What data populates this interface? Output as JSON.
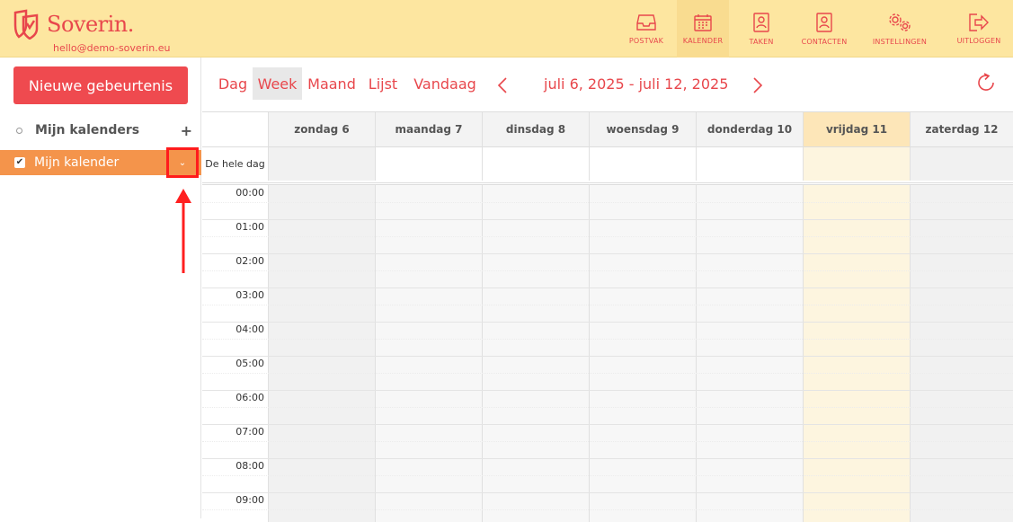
{
  "header": {
    "brand": "Soverin.",
    "email": "hello@demo-soverin.eu",
    "nav": [
      {
        "label": "POSTVAK",
        "icon": "inbox-icon"
      },
      {
        "label": "KALENDER",
        "icon": "calendar-icon",
        "active": true
      },
      {
        "label": "TAKEN",
        "icon": "tasks-icon"
      },
      {
        "label": "CONTACTEN",
        "icon": "contacts-icon"
      },
      {
        "label": "INSTELLINGEN",
        "icon": "settings-icon"
      },
      {
        "label": "UITLOGGEN",
        "icon": "logout-icon"
      }
    ]
  },
  "sidebar": {
    "new_event": "Nieuwe gebeurtenis",
    "my_calendars": "Mijn kalenders",
    "add": "+",
    "calendar_name": "Mijn kalender"
  },
  "toolbar": {
    "views": [
      "Dag",
      "Week",
      "Maand",
      "Lijst"
    ],
    "active_view": "Week",
    "today": "Vandaag",
    "range": "juli 6, 2025 - juli 12, 2025"
  },
  "calendar": {
    "all_day": "De hele dag",
    "days": [
      "zondag 6",
      "maandag 7",
      "dinsdag 8",
      "woensdag 9",
      "donderdag 10",
      "vrijdag 11",
      "zaterdag 12"
    ],
    "today_index": 5,
    "hours": [
      "00:00",
      "01:00",
      "02:00",
      "03:00",
      "04:00",
      "05:00",
      "06:00",
      "07:00",
      "08:00",
      "09:00"
    ]
  },
  "colors": {
    "accent": "#e8474c",
    "header_bg": "#fde6a0",
    "calendar_row": "#f4944b",
    "today_bg": "#fdf5df",
    "weekend_bg": "#f1f1f1",
    "workday_bg": "#f7f7f7"
  }
}
